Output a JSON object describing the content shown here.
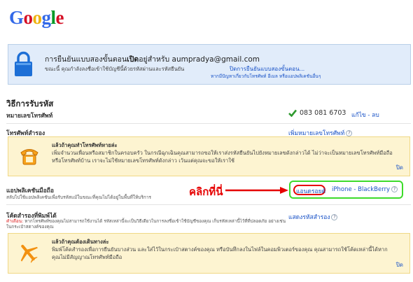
{
  "logo": {
    "letters": [
      "G",
      "o",
      "o",
      "g",
      "l",
      "e"
    ]
  },
  "banner": {
    "line1_prefix": "การยืนยันแบบสองขั้นตอน",
    "line1_bold": "เปิด",
    "line1_suffix": "อยู่สำหรับ aumpradya@gmail.com",
    "line2": "ขณะนี้ คุณกำลังลงชื่อเข้าใช้บัญชีนี้ด้วยรหัสผ่านและรหัสยืนยัน",
    "disable_link": "ปิดการยืนยันแบบสองขั้นตอน...",
    "sub_link": "หากมีปัญหาเกี่ยวกับโทรศัพท์ อีเมล หรือแอปพลิเคชันอื่นๆ"
  },
  "section_title": "วิธีการรับรหัส",
  "rows": {
    "phone_label": "หมายเลขโทรศัพท์",
    "phone_number": "083 081 6703",
    "edit_link": "แก้ไข - ลบ",
    "backup_phone_label": "โทรศัพท์สำรอง",
    "add_phone_link": "เพิ่มหมายเลขโทรศัพท์",
    "app_label": "แอปพลิเคชันมือถือ",
    "app_desc": "สลับไปใช้แอปพลิเคชันเพื่อรับรหัสแม้ในขณะที่คุณไม่ได้อยู่ในพื้นที่ให้บริการ",
    "android_link": "แอนดรอยด์",
    "iphone_link": "iPhone - BlackBerry",
    "backup_codes_label": "โค้ดสำรองที่พิมพ์ได้",
    "backup_warning": "คำเตือน:",
    "backup_desc": "หากโทรศัพท์ของคุณไม่สามารถใช้งานได้ รหัสเหล่านี้จะเป็นวิธีเดียวในการลงชื่อเข้าใช้บัญชีของคุณ เก็บรหัสเหล่านี้ไว้ที่ที่ปลอดภัย อย่างเช่นในกระเป๋าสตางค์ของคุณ",
    "show_codes_link": "แสดงรหัสสำรอง"
  },
  "note_phone": {
    "title": "แล้วถ้าคุณทำโทรศัพท์หายล่ะ",
    "text": "เพิ่มจำนวนเพื่อนหรือสมาชิกในครอบครัว ในกรณีฉุกเฉินคุณสามารถขอให้เราส่งรหัสยืนยันไปยังหมายเลขดังกล่าวได้ ไม่ว่าจะเป็นหมายเลขโทรศัพท์มือถือหรือโทรศัพท์บ้าน เราจะไม่ใช้หมายเลขโทรศัพท์ดังกล่าว เว้นแต่คุณจะขอให้เราใช้",
    "close": "ปิด"
  },
  "note_travel": {
    "title": "แล้วถ้าคุณต้องเดินทางล่ะ",
    "text": "พิมพ์โค้ดสำรองเพื่อการยืนยันบางส่วน และใส่ไว้ในกระเป๋าสตางค์ของคุณ หรือบันทึกลงในไฟล์ในคอมพิวเตอร์ของคุณ คุณสามารถใช้โค้ดเหล่านี้ได้หากคุณไม่มีสัญญาณโทรศัพท์มือถือ",
    "close": "ปิด"
  },
  "annotation": {
    "click_here": "คลิกที่นี่"
  },
  "help_glyph": "?",
  "colors": {
    "link": "#1a53c7",
    "banner_bg": "#e1ecfa",
    "note_bg": "#fdf4d1",
    "annotation_red": "#e60000",
    "annotation_green": "#3ddb2b"
  }
}
